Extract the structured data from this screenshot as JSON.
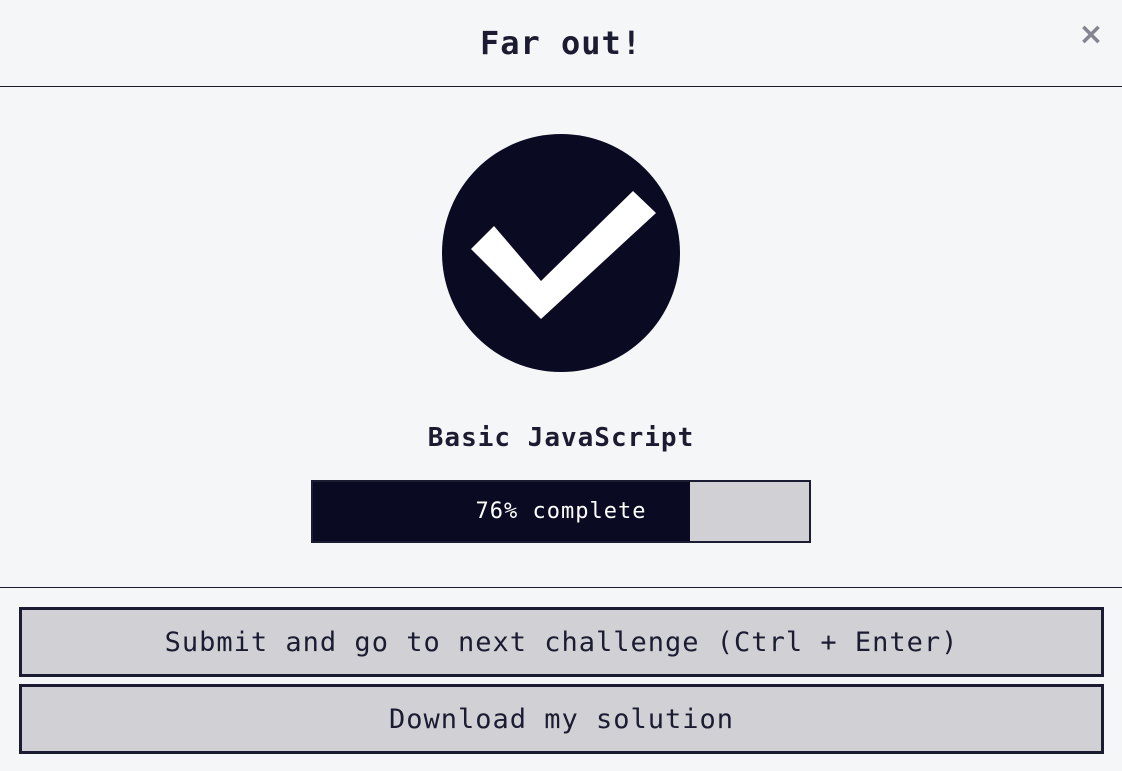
{
  "modal": {
    "title": "Far out!",
    "close_label": "×"
  },
  "block": {
    "title": "Basic JavaScript",
    "progress_percent": 76,
    "progress_label": "76% complete"
  },
  "buttons": {
    "submit_label": "Submit and go to next challenge (Ctrl + Enter)",
    "download_label": "Download my solution"
  },
  "colors": {
    "background": "#f5f6f7",
    "dark": "#0a0a23",
    "text": "#1b1b32",
    "button_bg": "#d0d0d5",
    "close_icon": "#858591"
  },
  "icons": {
    "success": "check-circle-icon",
    "close": "close-icon"
  }
}
